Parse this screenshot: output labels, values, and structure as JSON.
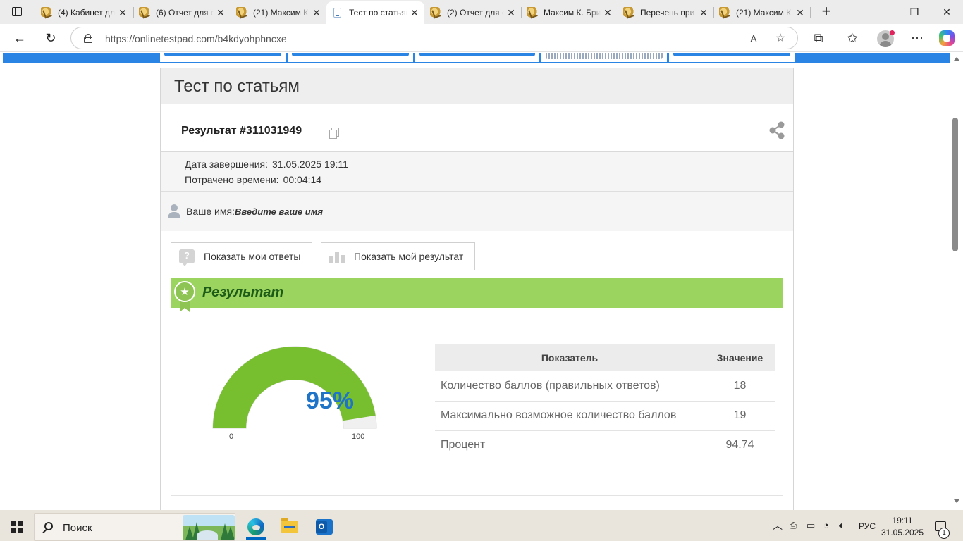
{
  "browser": {
    "tabs": [
      {
        "title": "(4) Кабинет для",
        "favicon": "gold-owl-icon",
        "active": false
      },
      {
        "title": "(6) Отчет для ст",
        "favicon": "gold-owl-icon",
        "active": false
      },
      {
        "title": "(21) Максим К.",
        "favicon": "gold-owl-icon",
        "active": false
      },
      {
        "title": "Тест по статьям",
        "favicon": "test-doc-icon",
        "active": true
      },
      {
        "title": "(2) Отчет для ст",
        "favicon": "gold-owl-icon",
        "active": false
      },
      {
        "title": "Максим К. Бри",
        "favicon": "gold-owl-icon",
        "active": false
      },
      {
        "title": "Перечень при",
        "favicon": "gold-owl-icon",
        "active": false
      },
      {
        "title": "(21) Максим К.",
        "favicon": "gold-owl-icon",
        "active": false
      }
    ],
    "url": "https://onlinetestpad.com/b4kdyohphncxe"
  },
  "page": {
    "test_title": "Тест по статьям",
    "result_title": "Результат #311031949",
    "completion_label": "Дата завершения:",
    "completion_value": "31.05.2025 19:11",
    "time_spent_label": "Потрачено времени:",
    "time_spent_value": "00:04:14",
    "name_label": "Ваше имя:",
    "name_placeholder": "Введите ваше имя",
    "buttons": {
      "show_answers": "Показать мои ответы",
      "show_result": "Показать мой результат"
    },
    "result_heading": "Результат",
    "gauge": {
      "percent": 95,
      "percent_text": "95%",
      "min_label": "0",
      "max_label": "100",
      "fill_color": "#77bf2e",
      "track_color": "#f0f0f0"
    },
    "table": {
      "headers": [
        "Показатель",
        "Значение"
      ],
      "rows": [
        {
          "name": "Количество баллов (правильных ответов)",
          "value": "18"
        },
        {
          "name": "Максимально возможное количество баллов",
          "value": "19"
        },
        {
          "name": "Процент",
          "value": "94.74"
        }
      ]
    },
    "colors": {
      "accent_blue": "#2a84e4",
      "banner_green": "#9bd45e",
      "banner_text": "#1d5b18",
      "percent_blue": "#1f74c8"
    }
  },
  "taskbar": {
    "search_placeholder": "Поиск",
    "language": "РУС",
    "time": "19:11",
    "date": "31.05.2025",
    "notification_count": "1"
  }
}
